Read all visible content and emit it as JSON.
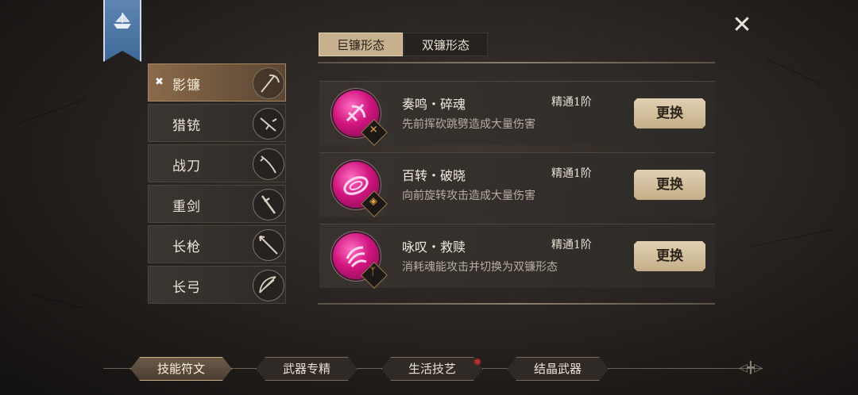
{
  "close_icon": "close-icon",
  "weapons": [
    {
      "label": "影镰",
      "icon": "scythe-icon",
      "active": true
    },
    {
      "label": "猎铳",
      "icon": "gun-icon",
      "active": false
    },
    {
      "label": "战刀",
      "icon": "blade-icon",
      "active": false
    },
    {
      "label": "重剑",
      "icon": "greatsword-icon",
      "active": false
    },
    {
      "label": "长枪",
      "icon": "spear-icon",
      "active": false
    },
    {
      "label": "长弓",
      "icon": "bow-icon",
      "active": false
    }
  ],
  "form_tabs": [
    {
      "label": "巨镰形态",
      "active": true
    },
    {
      "label": "双镰形态",
      "active": false
    }
  ],
  "skills": [
    {
      "name": "奏鸣・碎魂",
      "desc": "先前挥砍跳劈造成大量伤害",
      "level": "精通1阶",
      "button": "更换"
    },
    {
      "name": "百转・破晓",
      "desc": "向前旋转攻击造成大量伤害",
      "level": "精通1阶",
      "button": "更换"
    },
    {
      "name": "咏叹・救赎",
      "desc": "消耗魂能攻击并切换为双镰形态",
      "level": "精通1阶",
      "button": "更换"
    }
  ],
  "bottom_tabs": [
    {
      "label": "技能符文",
      "active": true
    },
    {
      "label": "武器专精",
      "active": false
    },
    {
      "label": "生活技艺",
      "active": false,
      "notification": true
    },
    {
      "label": "结晶武器",
      "active": false
    }
  ],
  "colors": {
    "accent": "#c6b08d",
    "skill_orb": "#d1157f",
    "notify": "#c42a2a"
  }
}
